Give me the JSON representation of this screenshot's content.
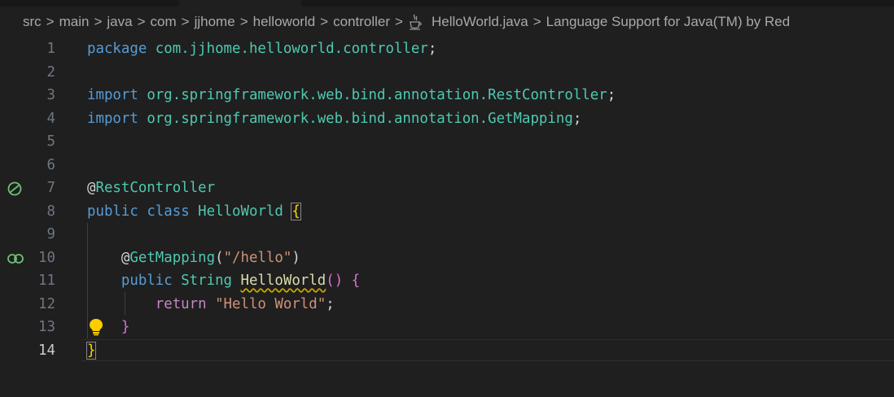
{
  "breadcrumb": {
    "items": [
      "src",
      "main",
      "java",
      "com",
      "jjhome",
      "helloworld",
      "controller"
    ],
    "separator": ">",
    "file": "HelloWorld.java",
    "file_icon": "java-coffee-icon",
    "outline": "Language Support for Java(TM) by Red"
  },
  "editor": {
    "active_line": 14,
    "line_numbers": [
      "1",
      "2",
      "3",
      "4",
      "5",
      "6",
      "7",
      "8",
      "9",
      "10",
      "11",
      "12",
      "13",
      "14"
    ],
    "tokens": {
      "package_kw": "package",
      "package_name": "com.jjhome.helloworld.controller",
      "semicolon": ";",
      "import_kw": "import",
      "import1": "org.springframework.web.bind.annotation.RestController",
      "import2": "org.springframework.web.bind.annotation.GetMapping",
      "at": "@",
      "rest_controller": "RestController",
      "public_kw": "public",
      "class_kw": "class",
      "class_name": "HelloWorld",
      "open_brace": "{",
      "close_brace": "}",
      "get_mapping": "GetMapping",
      "open_paren": "(",
      "close_paren": ")",
      "mapping_path": "\"/hello\"",
      "string_type": "String",
      "method_name": "HelloWorld",
      "parens": "()",
      "return_kw": "return",
      "return_value": "\"Hello World\""
    },
    "gutter_icons": {
      "line7": "spring-bean-icon",
      "line10": "spring-mapping-icon",
      "line13": "lightbulb-icon"
    }
  },
  "colors": {
    "background": "#1f1f1f",
    "keyword": "#569cd6",
    "control_keyword": "#c586c0",
    "type": "#4ec9b0",
    "function": "#dcdcaa",
    "string": "#ce9178",
    "bracket_level1": "#ffd700",
    "bracket_level2": "#da70d6",
    "spring_icon": "#6fbf73",
    "warning_squiggle": "#cca700"
  }
}
